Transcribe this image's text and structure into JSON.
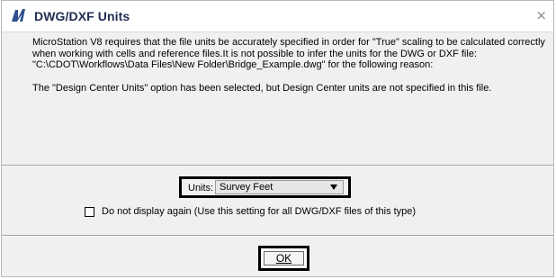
{
  "window": {
    "title": "DWG/DXF Units",
    "close_glyph": "×",
    "icon": "microstation-icon"
  },
  "message": {
    "paragraph1": "MicroStation V8 requires that the file units be accurately specified in order for \"True\" scaling to be calculated correctly when working with cells and reference files.It is not possible to infer the units for the DWG or DXF file: \"C:\\CDOT\\Workflows\\Data Files\\New Folder\\Bridge_Example.dwg\" for the following reason:",
    "paragraph2": "The \"Design Center Units\" option has been selected, but Design Center units are not specified in this file."
  },
  "units": {
    "label": "Units:",
    "selected": "Survey Feet"
  },
  "checkbox": {
    "label": "Do not display again (Use this setting for all DWG/DXF files of this type)",
    "checked": false
  },
  "buttons": {
    "ok_label": "OK"
  },
  "colors": {
    "title_text": "#1f2d4f",
    "dialog_bg": "#f0f0f0",
    "highlight_border": "#000000"
  }
}
